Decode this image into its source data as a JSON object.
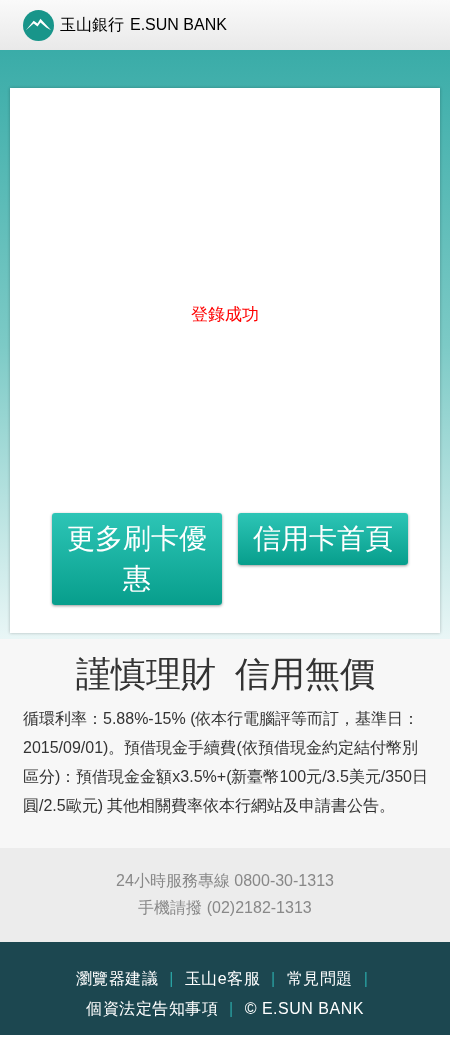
{
  "header": {
    "logo_text": "玉山銀行",
    "logo_subtext": "E.SUN BANK"
  },
  "card": {
    "message": "登錄成功",
    "buttons": [
      "更多刷卡優惠",
      "信用卡首頁"
    ]
  },
  "notice": {
    "title": "謹慎理財  信用無價",
    "body": "循環利率：5.88%-15% (依本行電腦評等而訂，基準日：2015/09/01)。預借現金手續費(依預借現金約定結付幣別區分)：預借現金金額x3.5%+(新臺幣100元/3.5美元/350日圓/2.5歐元) 其他相關費率依本行網站及申請書公告。"
  },
  "hotline": [
    "24小時服務專線 0800-30-1313",
    "手機請撥 (02)2182-1313"
  ],
  "footer": [
    {
      "kind": "link",
      "text": "瀏覽器建議"
    },
    {
      "kind": "separator",
      "text": "|"
    },
    {
      "kind": "link",
      "text": "玉山e客服"
    },
    {
      "kind": "separator",
      "text": "|"
    },
    {
      "kind": "link",
      "text": "常見問題"
    },
    {
      "kind": "separator",
      "text": "|"
    },
    {
      "kind": "link",
      "text": "個資法定告知事項"
    },
    {
      "kind": "separator",
      "text": "|"
    },
    {
      "kind": "copyright",
      "text": "© E.SUN BANK"
    }
  ]
}
